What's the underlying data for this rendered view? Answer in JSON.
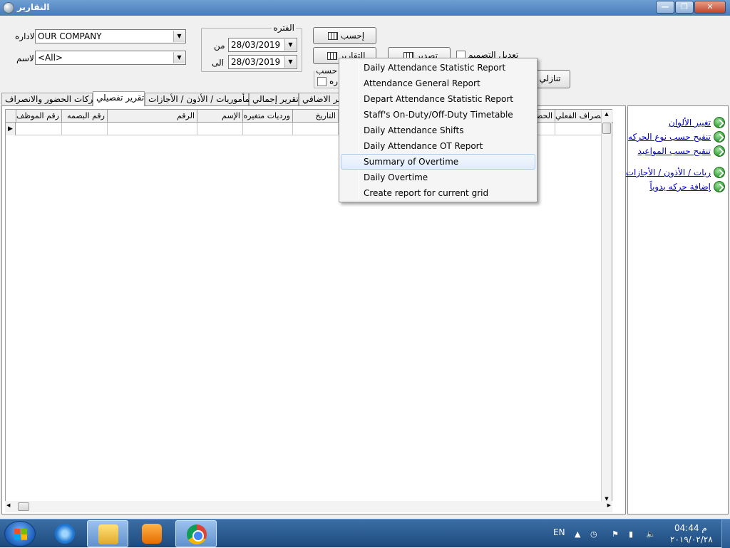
{
  "window": {
    "title": "التقارير"
  },
  "form": {
    "dept_label": "الاداره",
    "dept_value": "OUR COMPANY",
    "name_label": "الاسم",
    "name_value": "<All>",
    "period_legend": "الفتره",
    "from_label": "من",
    "from_value": "28/03/2019",
    "to_label": "الى",
    "to_value": "28/03/2019"
  },
  "buttons": {
    "calculate": "إحسب",
    "reports": "التقارير",
    "export": "تصدير",
    "descending": "تنازلي"
  },
  "checkboxes": {
    "edit_design": "تعديل التصميم",
    "by_label": "حسب",
    "by_sub": "ره"
  },
  "tabs": [
    "حركات الحضور والانصراف",
    "تقرير تفصيلي",
    "المأموريات / الأذون / الأجازات",
    "تقرير إجمالي",
    "ير الاضافي"
  ],
  "grid": {
    "columns": [
      "رقم الموظف",
      "رقم البصمه",
      "الرقم",
      "الإسم",
      "ورديات متغيره",
      "التاريخ",
      "",
      "الحضو",
      "الإنصراف الفعلي"
    ]
  },
  "links": [
    "تغيير الألوان",
    "تنقيح حسب نوع الحركه",
    "تنقيح حسب المواعيد",
    "ريات / الأذون / الأجازات",
    "إضافة حركه يدوياً"
  ],
  "menu": {
    "items": [
      "Daily Attendance Statistic Report",
      "Attendance General Report",
      "Depart Attendance Statistic Report",
      "Staff's On-Duty/Off-Duty Timetable",
      "Daily Attendance Shifts",
      "Daily Attendance OT Report",
      "Summary of Overtime",
      "Daily Overtime",
      "Create report for current grid"
    ],
    "hovered_index": 6
  },
  "taskbar": {
    "language": "EN",
    "time": "04:44 م",
    "date": "٢٠١٩/٠٢/٢٨"
  }
}
